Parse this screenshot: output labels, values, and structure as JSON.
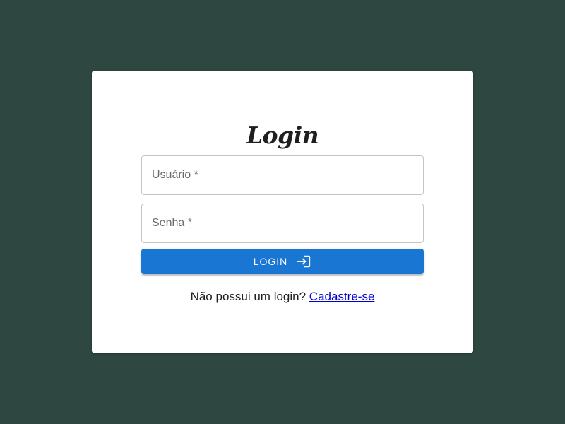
{
  "card": {
    "title": "Login"
  },
  "form": {
    "username": {
      "placeholder": "Usuário *",
      "value": ""
    },
    "password": {
      "placeholder": "Senha *",
      "value": ""
    },
    "submit_label": "LOGIN",
    "submit_icon": "login-icon"
  },
  "signup": {
    "prompt": "Não possui um login?",
    "link_label": "Cadastre-se"
  },
  "colors": {
    "background": "#2e4740",
    "card": "#ffffff",
    "primary": "#1976d2",
    "link": "#0000cc"
  }
}
